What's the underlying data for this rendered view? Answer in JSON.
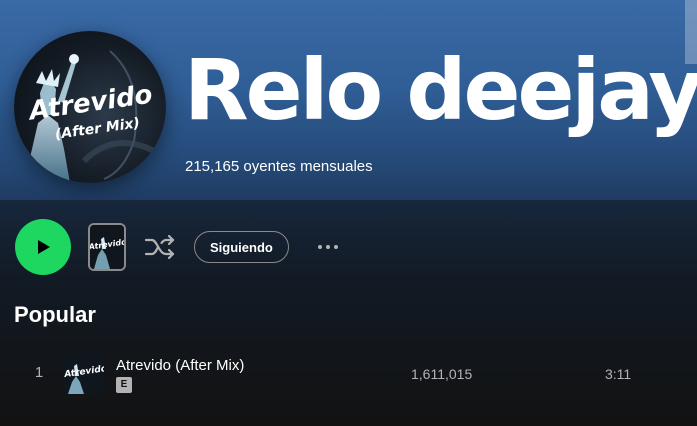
{
  "artist": {
    "name": "Relo deejay",
    "monthly_listeners": "215,165 oyentes mensuales",
    "avatar_text": "Atrevido (After Mix)"
  },
  "actions": {
    "follow_label": "Siguiendo"
  },
  "popular": {
    "title": "Popular",
    "tracks": [
      {
        "number": "1",
        "title": "Atrevido (After Mix)",
        "explicit": "E",
        "plays": "1,611,015",
        "duration": "3:11"
      }
    ]
  },
  "colors": {
    "accent": "#1ed760",
    "hero_top": "#3a6aa6",
    "background": "#121212",
    "muted_text": "#b3b3b3"
  },
  "icons": [
    "play-icon",
    "shuffle-icon",
    "more-options-icon"
  ]
}
